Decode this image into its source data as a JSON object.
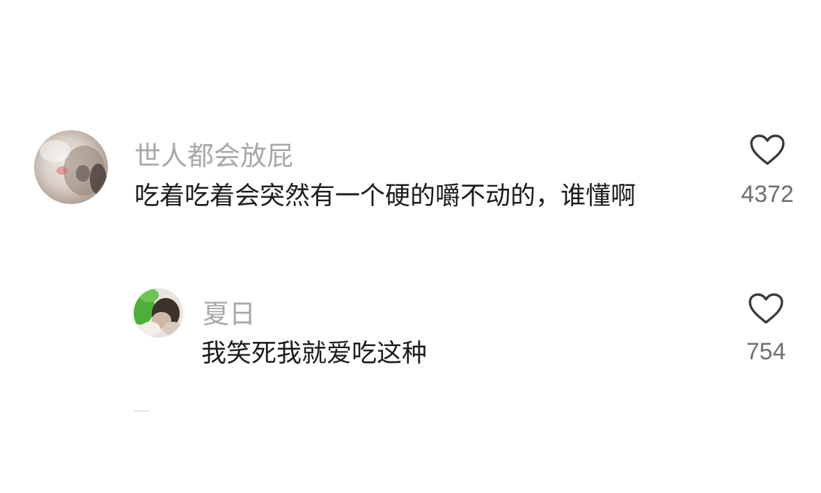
{
  "comments": [
    {
      "username": "世人都会放屁",
      "text": "吃着吃着会突然有一个硬的嚼不动的，谁懂啊",
      "like_count": "4372",
      "avatar_icon": "cat-photo-avatar"
    }
  ],
  "replies": [
    {
      "username": "夏日",
      "text": "我笑死我就爱吃这种",
      "like_count": "754",
      "avatar_icon": "person-photo-avatar"
    }
  ],
  "colors": {
    "username": "#a8a8a8",
    "text": "#1c1c1c",
    "like_count": "#6f6f6f",
    "heart_outline": "#3a3a3a"
  },
  "icons": {
    "like": "heart-outline-icon"
  }
}
